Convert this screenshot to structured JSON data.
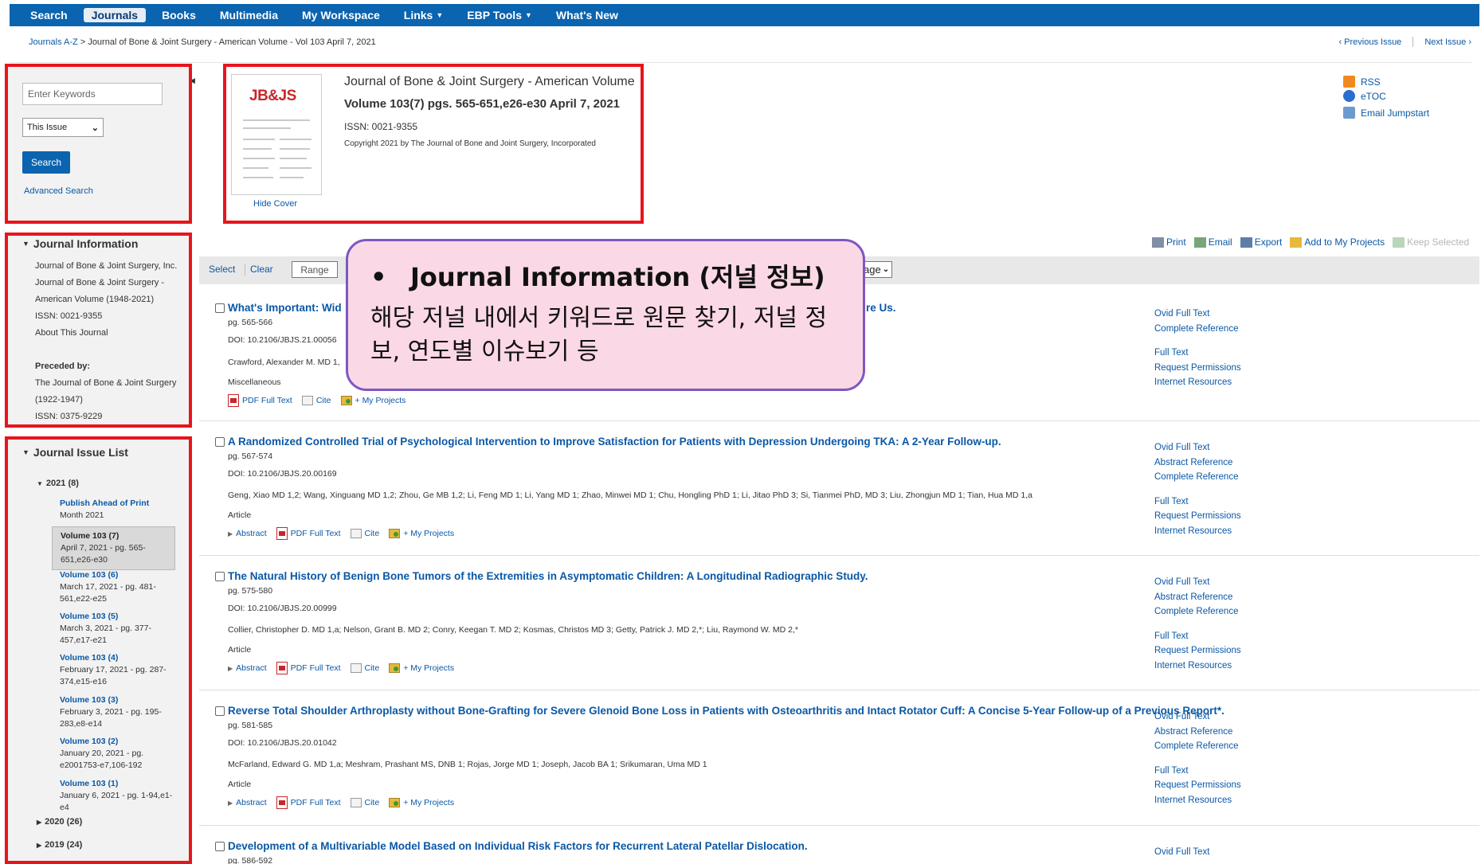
{
  "nav": {
    "items": [
      {
        "label": "Search",
        "dropdown": false,
        "active": false
      },
      {
        "label": "Journals",
        "dropdown": false,
        "active": true
      },
      {
        "label": "Books",
        "dropdown": false,
        "active": false
      },
      {
        "label": "Multimedia",
        "dropdown": false,
        "active": false
      },
      {
        "label": "My Workspace",
        "dropdown": false,
        "active": false
      },
      {
        "label": "Links",
        "dropdown": true,
        "active": false
      },
      {
        "label": "EBP Tools",
        "dropdown": true,
        "active": false
      },
      {
        "label": "What's New",
        "dropdown": false,
        "active": false
      }
    ]
  },
  "breadcrumb": {
    "root": "Journals A-Z",
    "separator": ">",
    "path": "Journal of Bone & Joint Surgery - American Volume - Vol 103 April 7, 2021"
  },
  "issue_nav": {
    "previous": "‹ Previous Issue",
    "next": "Next Issue ›"
  },
  "search_panel": {
    "keyword_placeholder": "Enter Keywords",
    "scope_value": "This Issue",
    "search_label": "Search",
    "advanced_label": "Advanced Search"
  },
  "journal_header": {
    "cover_logo": "JB&JS",
    "hide_cover": "Hide Cover",
    "title": "Journal of Bone & Joint Surgery - American Volume",
    "volume_line": "Volume 103(7) pgs. 565-651,e26-e30 April 7, 2021",
    "issn_line": "ISSN: 0021-9355",
    "copyright": "Copyright 2021 by The Journal of Bone and Joint Surgery, Incorporated"
  },
  "feeds": [
    {
      "label": "RSS",
      "icon": "rss-icon",
      "color": "#f0891f"
    },
    {
      "label": "eTOC",
      "icon": "etoc-icon",
      "color": "#2a6fd0"
    },
    {
      "label": "Email Jumpstart",
      "icon": "email-jumpstart-icon",
      "color": "#6c9bcf"
    }
  ],
  "journal_info": {
    "heading": "Journal Information",
    "publisher_link": "Journal of Bone & Joint Surgery, Inc.",
    "name_line1": "Journal of Bone & Joint Surgery -",
    "name_line2": "American Volume (1948-2021)",
    "issn": "ISSN: 0021-9355",
    "about_link": "About This Journal",
    "preceded_by_label": "Preceded by:",
    "preceded_link": "The Journal of Bone & Joint Surgery",
    "preceded_years": "(1922-1947)",
    "preceded_issn": "ISSN: 0375-9229"
  },
  "issue_list": {
    "heading": "Journal Issue List",
    "year_open": "2021 (8)",
    "volumes": [
      {
        "title": "Publish Ahead of Print",
        "detail": "Month 2021",
        "selected": false
      },
      {
        "title": "Volume 103 (7)",
        "detail": "April 7, 2021 - pg. 565-651,e26-e30",
        "selected": true
      },
      {
        "title": "Volume 103 (6)",
        "detail": "March 17, 2021 - pg. 481-561,e22-e25",
        "selected": false
      },
      {
        "title": "Volume 103 (5)",
        "detail": "March 3, 2021 - pg. 377-457,e17-e21",
        "selected": false
      },
      {
        "title": "Volume 103 (4)",
        "detail": "February 17, 2021 - pg. 287-374,e15-e16",
        "selected": false
      },
      {
        "title": "Volume 103 (3)",
        "detail": "February 3, 2021 - pg. 195-283,e8-e14",
        "selected": false
      },
      {
        "title": "Volume 103 (2)",
        "detail": "January 20, 2021 - pg. e2001753-e7,106-192",
        "selected": false
      },
      {
        "title": "Volume 103 (1)",
        "detail": "January 6, 2021 - pg. 1-94,e1-e4",
        "selected": false
      }
    ],
    "year_2020": "2020 (26)",
    "year_2019": "2019 (24)"
  },
  "toolbar": {
    "print": "Print",
    "email": "Email",
    "export": "Export",
    "add_projects": "Add to My Projects",
    "keep_selected": "Keep Selected"
  },
  "select_bar": {
    "select": "Select",
    "clear": "Clear",
    "range": "Range",
    "per_page_value": "age"
  },
  "callout": {
    "bullet": "•",
    "title": "Journal Information (저널 정보)",
    "body": "해당 저널 내에서 키워드로 원문 찾기, 저널 정보, 연도별 이슈보기 등"
  },
  "article_actions": {
    "abstract": "Abstract",
    "pdf": "PDF Full Text",
    "cite": "Cite",
    "projects": "+ My Projects"
  },
  "articles": [
    {
      "title": "What's Important: Wid",
      "title_tail": "re Us.",
      "pages": "pg. 565-566",
      "doi": "DOI: 10.2106/JBJS.21.00056",
      "authors": "Crawford, Alexander M. MD 1,",
      "type": "Miscellaneous",
      "links": [
        "Ovid Full Text",
        "Complete Reference",
        "Full Text",
        "Request Permissions",
        "Internet Resources"
      ]
    },
    {
      "title": "A Randomized Controlled Trial of Psychological Intervention to Improve Satisfaction for Patients with Depression Undergoing TKA: A 2-Year Follow-up.",
      "title_tail": "",
      "pages": "pg. 567-574",
      "doi": "DOI: 10.2106/JBJS.20.00169",
      "authors": "Geng, Xiao MD 1,2; Wang, Xinguang MD 1,2; Zhou, Ge MB 1,2; Li, Feng MD 1; Li, Yang MD 1; Zhao, Minwei MD 1; Chu, Hongling PhD 1; Li, Jitao PhD 3; Si, Tianmei PhD, MD 3; Liu, Zhongjun MD 1; Tian, Hua MD 1,a",
      "type": "Article",
      "links": [
        "Ovid Full Text",
        "Abstract Reference",
        "Complete Reference",
        "Full Text",
        "Request Permissions",
        "Internet Resources"
      ]
    },
    {
      "title": "The Natural History of Benign Bone Tumors of the Extremities in Asymptomatic Children: A Longitudinal Radiographic Study.",
      "title_tail": "",
      "pages": "pg. 575-580",
      "doi": "DOI: 10.2106/JBJS.20.00999",
      "authors": "Collier, Christopher D. MD 1,a; Nelson, Grant B. MD 2; Conry, Keegan T. MD 2; Kosmas, Christos MD 3; Getty, Patrick J. MD 2,*; Liu, Raymond W. MD 2,*",
      "type": "Article",
      "links": [
        "Ovid Full Text",
        "Abstract Reference",
        "Complete Reference",
        "Full Text",
        "Request Permissions",
        "Internet Resources"
      ]
    },
    {
      "title": "Reverse Total Shoulder Arthroplasty without Bone-Grafting for Severe Glenoid Bone Loss in Patients with Osteoarthritis and Intact Rotator Cuff: A Concise 5-Year Follow-up of a Previous Report*.",
      "title_tail": "",
      "pages": "pg. 581-585",
      "doi": "DOI: 10.2106/JBJS.20.01042",
      "authors": "McFarland, Edward G. MD 1,a; Meshram, Prashant MS, DNB 1; Rojas, Jorge MD 1; Joseph, Jacob BA 1; Srikumaran, Uma MD 1",
      "type": "Article",
      "links": [
        "Ovid Full Text",
        "Abstract Reference",
        "Complete Reference",
        "Full Text",
        "Request Permissions",
        "Internet Resources"
      ]
    },
    {
      "title": "Development of a Multivariable Model Based on Individual Risk Factors for Recurrent Lateral Patellar Dislocation.",
      "title_tail": "",
      "pages": "pg. 586-592",
      "links": [
        "Ovid Full Text"
      ]
    }
  ]
}
